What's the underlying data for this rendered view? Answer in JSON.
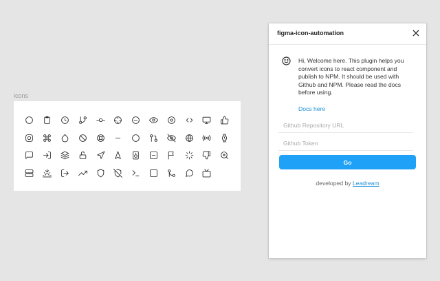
{
  "canvas": {
    "frame_label": "icons",
    "icons": [
      "circle-icon",
      "clipboard-icon",
      "clock-icon",
      "git-branch-icon",
      "git-commit-icon",
      "crosshair-icon",
      "minus-circle-icon",
      "eye-icon",
      "disc-icon",
      "code-icon",
      "monitor-icon",
      "thumbs-up-icon",
      "instagram-icon",
      "command-icon",
      "droplet-icon",
      "slash-icon",
      "life-buoy-icon",
      "minus-icon",
      "circle-outline-icon",
      "git-pull-request-icon",
      "eye-off-icon",
      "globe-icon",
      "radio-icon",
      "watch-icon",
      "message-square-icon",
      "log-in-icon",
      "layers-icon",
      "unlock-icon",
      "navigation-icon",
      "navigation-2-icon",
      "speaker-icon",
      "minus-square-icon",
      "flag-icon",
      "loader-icon",
      "thumbs-down-icon",
      "zoom-in-icon",
      "server-icon",
      "sunset-icon",
      "log-out-icon",
      "trending-up-icon",
      "shield-icon",
      "shield-off-icon",
      "terminal-icon",
      "square-icon",
      "git-merge-icon",
      "message-circle-icon",
      "tv-icon"
    ]
  },
  "plugin": {
    "title": "figma-icon-automation",
    "welcome_text": "Hi, Welcome here. This plugin helps you convert icons to react component and publish to NPM. It should be used with Github and NPM. Please read the docs before using.",
    "docs_link": "Docs here",
    "repo_placeholder": "Github Repository URL",
    "token_placeholder": "Github Token",
    "go_label": "Go",
    "footer_prefix": "developed by ",
    "footer_link": "Leadream",
    "accent_color": "#1ea1f7"
  }
}
